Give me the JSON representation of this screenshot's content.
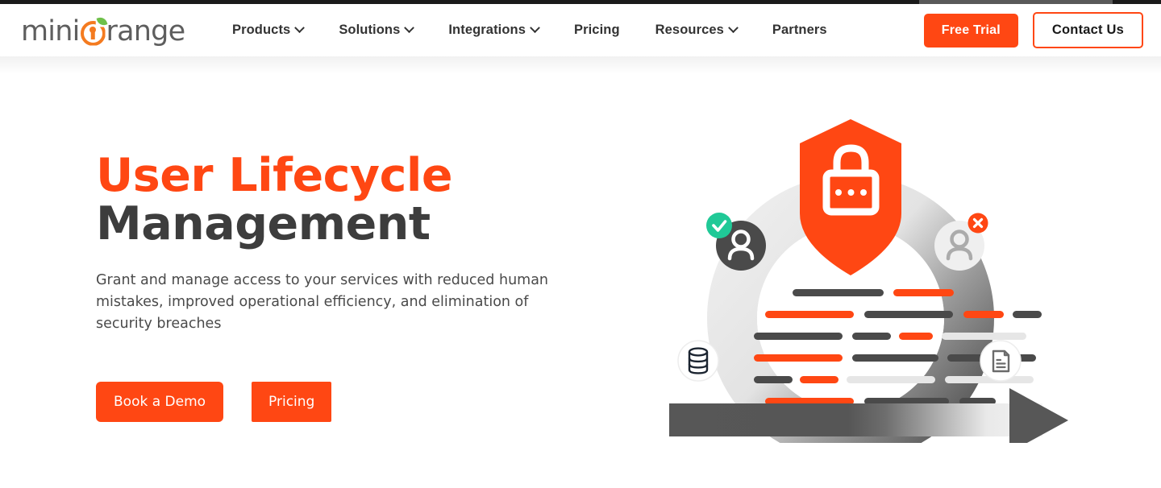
{
  "brand": {
    "logo_text_left": "mini",
    "logo_text_right": "range",
    "logo_mark_icon": "orange-keyhole-circle-icon",
    "accent_color": "#FF4713",
    "logo_orange": "#F47B20",
    "logo_gray": "#5E5E5E",
    "leaf_green": "#6FC04A"
  },
  "header": {
    "nav": [
      {
        "label": "Products",
        "has_dropdown": true,
        "icon": "chevron-down-icon"
      },
      {
        "label": "Solutions",
        "has_dropdown": true,
        "icon": "chevron-down-icon"
      },
      {
        "label": "Integrations",
        "has_dropdown": true,
        "icon": "chevron-down-icon"
      },
      {
        "label": "Pricing",
        "has_dropdown": false,
        "icon": ""
      },
      {
        "label": "Resources",
        "has_dropdown": true,
        "icon": "chevron-down-icon"
      },
      {
        "label": "Partners",
        "has_dropdown": false,
        "icon": ""
      }
    ],
    "free_trial_label": "Free Trial",
    "contact_label": "Contact Us"
  },
  "hero": {
    "title_accent": "User Lifecycle",
    "title_plain": "Management",
    "subtitle": "Grant and manage access to your services with reduced human mistakes, improved operational efficiency, and elimination of security breaches",
    "cta_primary": "Book a Demo",
    "cta_secondary": "Pricing"
  },
  "illustration": {
    "shield_icon": "shield-padlock-icon",
    "ring_icon": "circular-arrow-ring",
    "arrow_icon": "right-arrow-icon",
    "avatar_approved_icon": "user-avatar-approved-icon",
    "avatar_approved_badge": "check-badge-icon",
    "avatar_denied_icon": "user-avatar-denied-icon",
    "avatar_denied_badge": "x-badge-icon",
    "database_icon": "database-icon",
    "document_icon": "document-icon",
    "check_color": "#20C997",
    "deny_color": "#FF4713",
    "dark_gray": "#4A4A4A",
    "light_gray": "#E6E6E6"
  }
}
